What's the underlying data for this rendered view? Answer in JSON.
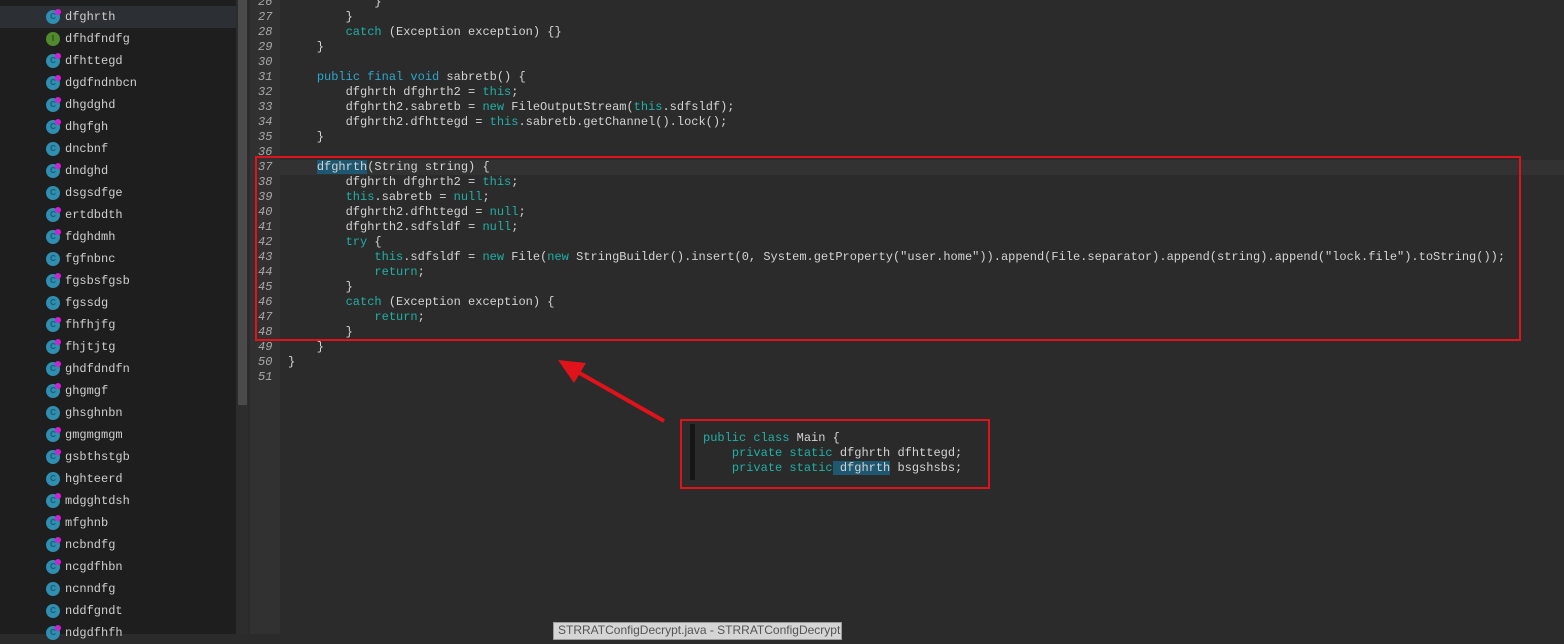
{
  "sidebar": {
    "items": [
      {
        "label": "dfghrth",
        "kind": "class",
        "badge": true,
        "selected": true
      },
      {
        "label": "dfhdfndfg",
        "kind": "interface",
        "badge": false
      },
      {
        "label": "dfhttegd",
        "kind": "class",
        "badge": true
      },
      {
        "label": "dgdfndnbcn",
        "kind": "class",
        "badge": true
      },
      {
        "label": "dhgdghd",
        "kind": "class",
        "badge": true
      },
      {
        "label": "dhgfgh",
        "kind": "class",
        "badge": true
      },
      {
        "label": "dncbnf",
        "kind": "class",
        "badge": false
      },
      {
        "label": "dndghd",
        "kind": "class",
        "badge": true
      },
      {
        "label": "dsgsdfge",
        "kind": "class",
        "badge": false
      },
      {
        "label": "ertdbdth",
        "kind": "class",
        "badge": true
      },
      {
        "label": "fdghdmh",
        "kind": "class",
        "badge": true
      },
      {
        "label": "fgfnbnc",
        "kind": "class",
        "badge": false
      },
      {
        "label": "fgsbsfgsb",
        "kind": "class",
        "badge": true
      },
      {
        "label": "fgssdg",
        "kind": "class",
        "badge": false
      },
      {
        "label": "fhfhjfg",
        "kind": "class",
        "badge": true
      },
      {
        "label": "fhjtjtg",
        "kind": "class",
        "badge": true
      },
      {
        "label": "ghdfdndfn",
        "kind": "class",
        "badge": true
      },
      {
        "label": "ghgmgf",
        "kind": "class",
        "badge": true
      },
      {
        "label": "ghsghnbn",
        "kind": "class",
        "badge": false
      },
      {
        "label": "gmgmgmgm",
        "kind": "class",
        "badge": true
      },
      {
        "label": "gsbthstgb",
        "kind": "class",
        "badge": true
      },
      {
        "label": "hghteerd",
        "kind": "class",
        "badge": false
      },
      {
        "label": "mdgghtdsh",
        "kind": "class",
        "badge": true
      },
      {
        "label": "mfghnb",
        "kind": "class",
        "badge": true
      },
      {
        "label": "ncbndfg",
        "kind": "class",
        "badge": true
      },
      {
        "label": "ncgdfhbn",
        "kind": "class",
        "badge": true
      },
      {
        "label": "ncnndfg",
        "kind": "class",
        "badge": false
      },
      {
        "label": "nddfgndt",
        "kind": "class",
        "badge": false
      },
      {
        "label": "ndgdfhfh",
        "kind": "class",
        "badge": true
      }
    ]
  },
  "editor": {
    "current_line": 37,
    "lines": [
      {
        "n": "26",
        "t": [
          [
            "",
            "            }"
          ]
        ]
      },
      {
        "n": "27",
        "t": [
          [
            "",
            "        }"
          ]
        ]
      },
      {
        "n": "28",
        "t": [
          [
            "",
            "        "
          ],
          [
            "kw2",
            "catch"
          ],
          [
            "",
            " (Exception exception) {}"
          ]
        ]
      },
      {
        "n": "29",
        "t": [
          [
            "",
            "    }"
          ]
        ]
      },
      {
        "n": "30",
        "t": []
      },
      {
        "n": "31",
        "t": [
          [
            "",
            "    "
          ],
          [
            "kw",
            "public final void"
          ],
          [
            "",
            " sabretb() {"
          ]
        ]
      },
      {
        "n": "32",
        "t": [
          [
            "",
            "        dfghrth dfghrth2 = "
          ],
          [
            "kw2",
            "this"
          ],
          [
            "",
            ";"
          ]
        ]
      },
      {
        "n": "33",
        "t": [
          [
            "",
            "        dfghrth2.sabretb = "
          ],
          [
            "kw2",
            "new"
          ],
          [
            "",
            " FileOutputStream("
          ],
          [
            "kw2",
            "this"
          ],
          [
            "",
            ".sdfsldf);"
          ]
        ]
      },
      {
        "n": "34",
        "t": [
          [
            "",
            "        dfghrth2.dfhttegd = "
          ],
          [
            "kw2",
            "this"
          ],
          [
            "",
            ".sabretb.getChannel().lock();"
          ]
        ]
      },
      {
        "n": "35",
        "t": [
          [
            "",
            "    }"
          ]
        ]
      },
      {
        "n": "36",
        "t": []
      },
      {
        "n": "37",
        "t": [
          [
            "",
            "    "
          ],
          [
            "hl",
            "dfghrth"
          ],
          [
            "",
            "(String string) {"
          ]
        ]
      },
      {
        "n": "38",
        "t": [
          [
            "",
            "        dfghrth dfghrth2 = "
          ],
          [
            "kw2",
            "this"
          ],
          [
            "",
            ";"
          ]
        ]
      },
      {
        "n": "39",
        "t": [
          [
            "",
            "        "
          ],
          [
            "kw2",
            "this"
          ],
          [
            "",
            ".sabretb = "
          ],
          [
            "kw2",
            "null"
          ],
          [
            "",
            ";"
          ]
        ]
      },
      {
        "n": "40",
        "t": [
          [
            "",
            "        dfghrth2.dfhttegd = "
          ],
          [
            "kw2",
            "null"
          ],
          [
            "",
            ";"
          ]
        ]
      },
      {
        "n": "41",
        "t": [
          [
            "",
            "        dfghrth2.sdfsldf = "
          ],
          [
            "kw2",
            "null"
          ],
          [
            "",
            ";"
          ]
        ]
      },
      {
        "n": "42",
        "t": [
          [
            "",
            "        "
          ],
          [
            "kw2",
            "try"
          ],
          [
            "",
            " {"
          ]
        ]
      },
      {
        "n": "43",
        "t": [
          [
            "",
            "            "
          ],
          [
            "kw2",
            "this"
          ],
          [
            "",
            ".sdfsldf = "
          ],
          [
            "kw2",
            "new"
          ],
          [
            "",
            " File("
          ],
          [
            "kw2",
            "new"
          ],
          [
            "",
            " StringBuilder().insert(0, System.getProperty(\"user.home\")).append(File.separator).append(string).append(\"lock.file\").toString());"
          ]
        ]
      },
      {
        "n": "44",
        "t": [
          [
            "",
            "            "
          ],
          [
            "kw2",
            "return"
          ],
          [
            "",
            ";"
          ]
        ]
      },
      {
        "n": "45",
        "t": [
          [
            "",
            "        }"
          ]
        ]
      },
      {
        "n": "46",
        "t": [
          [
            "",
            "        "
          ],
          [
            "kw2",
            "catch"
          ],
          [
            "",
            " (Exception exception) {"
          ]
        ]
      },
      {
        "n": "47",
        "t": [
          [
            "",
            "            "
          ],
          [
            "kw2",
            "return"
          ],
          [
            "",
            ";"
          ]
        ]
      },
      {
        "n": "48",
        "t": [
          [
            "",
            "        }"
          ]
        ]
      },
      {
        "n": "49",
        "t": [
          [
            "",
            "    }"
          ]
        ]
      },
      {
        "n": "50",
        "t": [
          [
            "",
            "}"
          ]
        ]
      },
      {
        "n": "51",
        "t": []
      }
    ]
  },
  "inset": {
    "lines": [
      [
        [
          "kw2",
          "public class"
        ],
        [
          "",
          " Main {"
        ]
      ],
      [
        [
          "",
          "    "
        ],
        [
          "kw2",
          "private static"
        ],
        [
          "",
          " dfghrth dfhttegd;"
        ]
      ],
      [
        [
          "",
          "    "
        ],
        [
          "kw2",
          "private static"
        ],
        [
          "hl",
          " dfghrth"
        ],
        [
          "",
          " bsgshsbs;"
        ]
      ]
    ]
  },
  "annotation": {
    "color": "#e0131b",
    "icon": "arrow-pointer"
  },
  "tooltip": {
    "text": "STRRATConfigDecrypt.java - STRRATConfigDecrypt -"
  }
}
